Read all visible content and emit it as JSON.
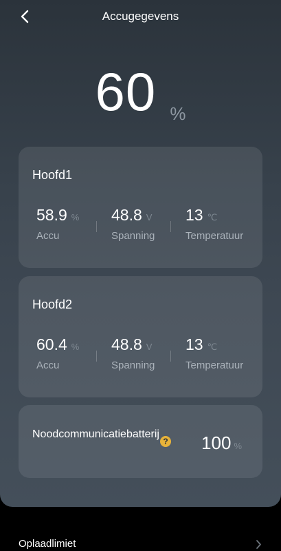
{
  "header": {
    "title": "Accugegevens",
    "back_icon": "chevron-left-icon"
  },
  "summary": {
    "value": "60",
    "unit": "%"
  },
  "batteries": [
    {
      "name": "Hoofd1",
      "stats": [
        {
          "value": "58.9",
          "unit": "%",
          "label": "Accu"
        },
        {
          "value": "48.8",
          "unit": "V",
          "label": "Spanning"
        },
        {
          "value": "13",
          "unit": "℃",
          "label": "Temperatuur"
        }
      ]
    },
    {
      "name": "Hoofd2",
      "stats": [
        {
          "value": "60.4",
          "unit": "%",
          "label": "Accu"
        },
        {
          "value": "48.8",
          "unit": "V",
          "label": "Spanning"
        },
        {
          "value": "13",
          "unit": "℃",
          "label": "Temperatuur"
        }
      ]
    }
  ],
  "emergency": {
    "label": "Noodcommunicatiebatterij",
    "help_icon": "question-circle-icon",
    "help_symbol": "?",
    "value": "100",
    "unit": "%"
  },
  "bottom": {
    "label": "Oplaadlimiet",
    "icon": "chevron-right-icon"
  },
  "colors": {
    "accent_help": "#e8b33a",
    "card_bg": "rgba(255,255,255,0.09)",
    "panel_top": "#2b333b",
    "panel_bottom": "#444f5a"
  }
}
